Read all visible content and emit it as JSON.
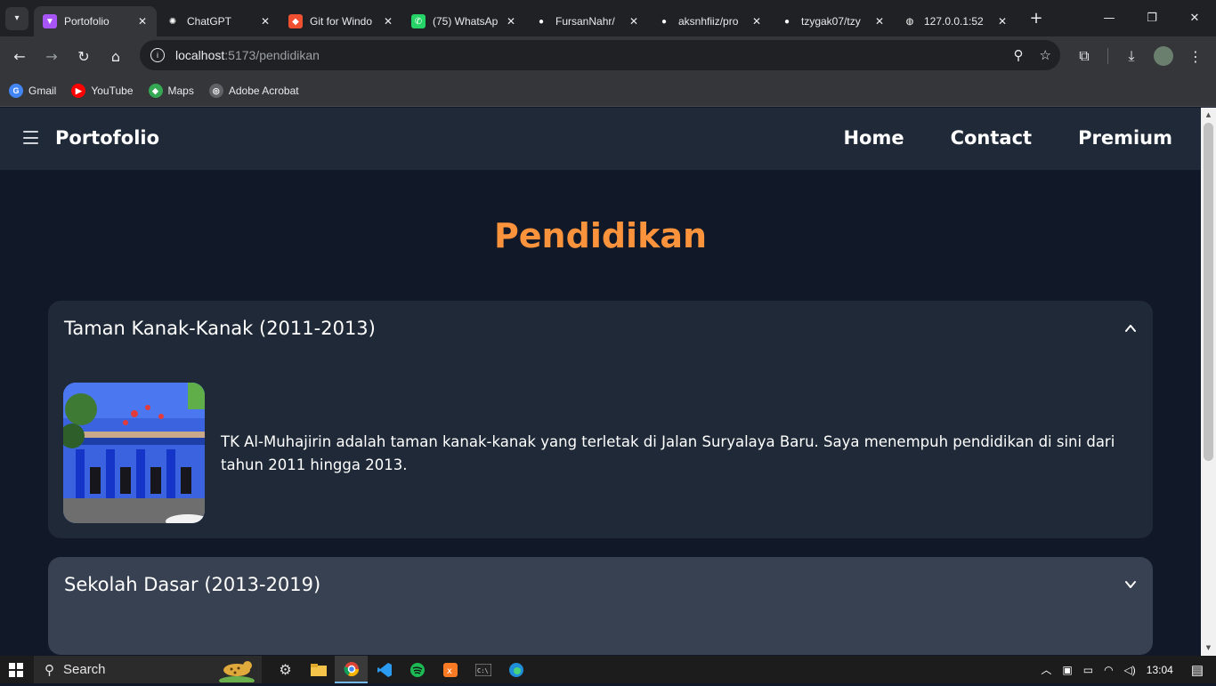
{
  "browser": {
    "tabs": [
      {
        "title": "Portofolio",
        "active": true,
        "icon": "vite-icon",
        "color": "#a855f7"
      },
      {
        "title": "ChatGPT",
        "active": false,
        "icon": "chatgpt-icon",
        "color": "#202124"
      },
      {
        "title": "Git for Windo",
        "active": false,
        "icon": "git-icon",
        "color": "#f05032"
      },
      {
        "title": "(75) WhatsAp",
        "active": false,
        "icon": "whatsapp-icon",
        "color": "#25d366"
      },
      {
        "title": "FursanNahr/",
        "active": false,
        "icon": "github-icon",
        "color": "#202124"
      },
      {
        "title": "aksnhfiiz/pro",
        "active": false,
        "icon": "github-icon",
        "color": "#202124"
      },
      {
        "title": "tzygak07/tzy",
        "active": false,
        "icon": "github-icon",
        "color": "#202124"
      },
      {
        "title": "127.0.0.1:52",
        "active": false,
        "icon": "globe-icon",
        "color": "#202124"
      }
    ],
    "url_host": "localhost",
    "url_path": ":5173/pendidikan",
    "bookmarks": [
      {
        "label": "Gmail",
        "icon": "google-icon",
        "color": "#4285f4",
        "glyph": "G"
      },
      {
        "label": "YouTube",
        "icon": "youtube-icon",
        "color": "#ff0000",
        "glyph": "▶"
      },
      {
        "label": "Maps",
        "icon": "maps-icon",
        "color": "#34a853",
        "glyph": "◆"
      },
      {
        "label": "Adobe Acrobat",
        "icon": "globe-icon",
        "color": "#5f6368",
        "glyph": "◎"
      }
    ]
  },
  "site": {
    "brand": "Portofolio",
    "nav": {
      "home": "Home",
      "contact": "Contact",
      "premium": "Premium"
    },
    "heading": "Pendidikan",
    "cards": [
      {
        "title": "Taman Kanak-Kanak (2011-2013)",
        "expanded": true,
        "description": "TK Al-Muhajirin adalah taman kanak-kanak yang terletak di Jalan Suryalaya Baru. Saya menempuh pendidikan di sini dari tahun 2011 hingga 2013."
      },
      {
        "title": "Sekolah Dasar (2013-2019)",
        "expanded": false
      }
    ]
  },
  "taskbar": {
    "search_placeholder": "Search",
    "time": "13:04"
  },
  "colors": {
    "accent": "#fb923c",
    "page_bg": "#111827",
    "navbar_bg": "#1f2937",
    "card_open_bg": "#1f2937",
    "card_closed_bg": "#374151"
  }
}
